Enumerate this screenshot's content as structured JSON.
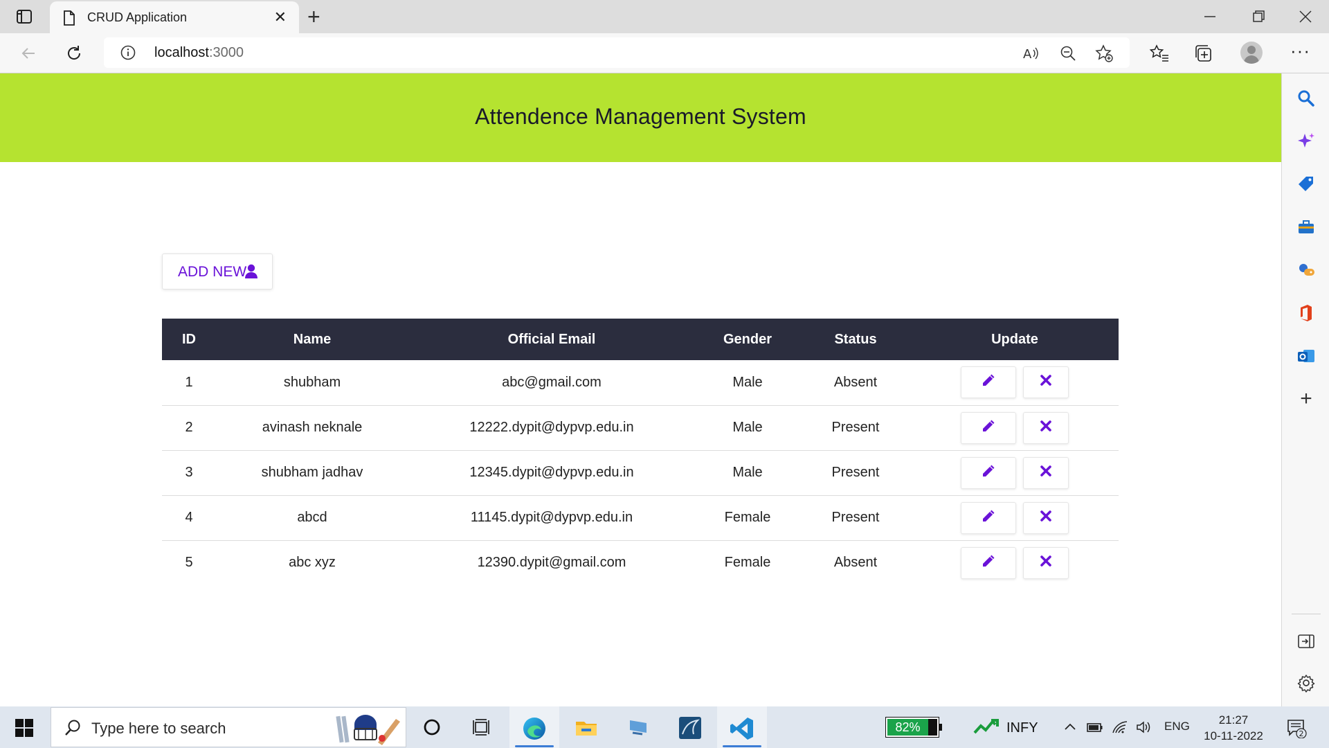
{
  "browser": {
    "tab_title": "CRUD Application",
    "url_host": "localhost",
    "url_port": ":3000"
  },
  "page": {
    "header_title": "Attendence Management System",
    "add_button_label": "ADD NEW",
    "columns": [
      "ID",
      "Name",
      "Official Email",
      "Gender",
      "Status",
      "Update"
    ],
    "rows": [
      {
        "id": "1",
        "name": "shubham",
        "email": "abc@gmail.com",
        "gender": "Male",
        "status": "Absent"
      },
      {
        "id": "2",
        "name": "avinash neknale",
        "email": "12222.dypit@dypvp.edu.in",
        "gender": "Male",
        "status": "Present"
      },
      {
        "id": "3",
        "name": "shubham jadhav",
        "email": "12345.dypit@dypvp.edu.in",
        "gender": "Male",
        "status": "Present"
      },
      {
        "id": "4",
        "name": "abcd",
        "email": "11145.dypit@dypvp.edu.in",
        "gender": "Female",
        "status": "Present"
      },
      {
        "id": "5",
        "name": "abc xyz",
        "email": "12390.dypit@gmail.com",
        "gender": "Female",
        "status": "Absent"
      }
    ],
    "icons": {
      "edit": "pencil-icon",
      "delete": "close-icon",
      "add": "user-icon"
    }
  },
  "taskbar": {
    "search_placeholder": "Type here to search",
    "battery_percent": "82%",
    "battery_level": 0.82,
    "stock_label": "INFY",
    "language": "ENG",
    "time": "21:27",
    "date": "10-11-2022",
    "notification_count": "2"
  },
  "colors": {
    "header_bg": "#b5e330",
    "table_header_bg": "#2b2d3e",
    "accent_purple": "#6a12d8",
    "battery_green": "#1aa34a"
  }
}
